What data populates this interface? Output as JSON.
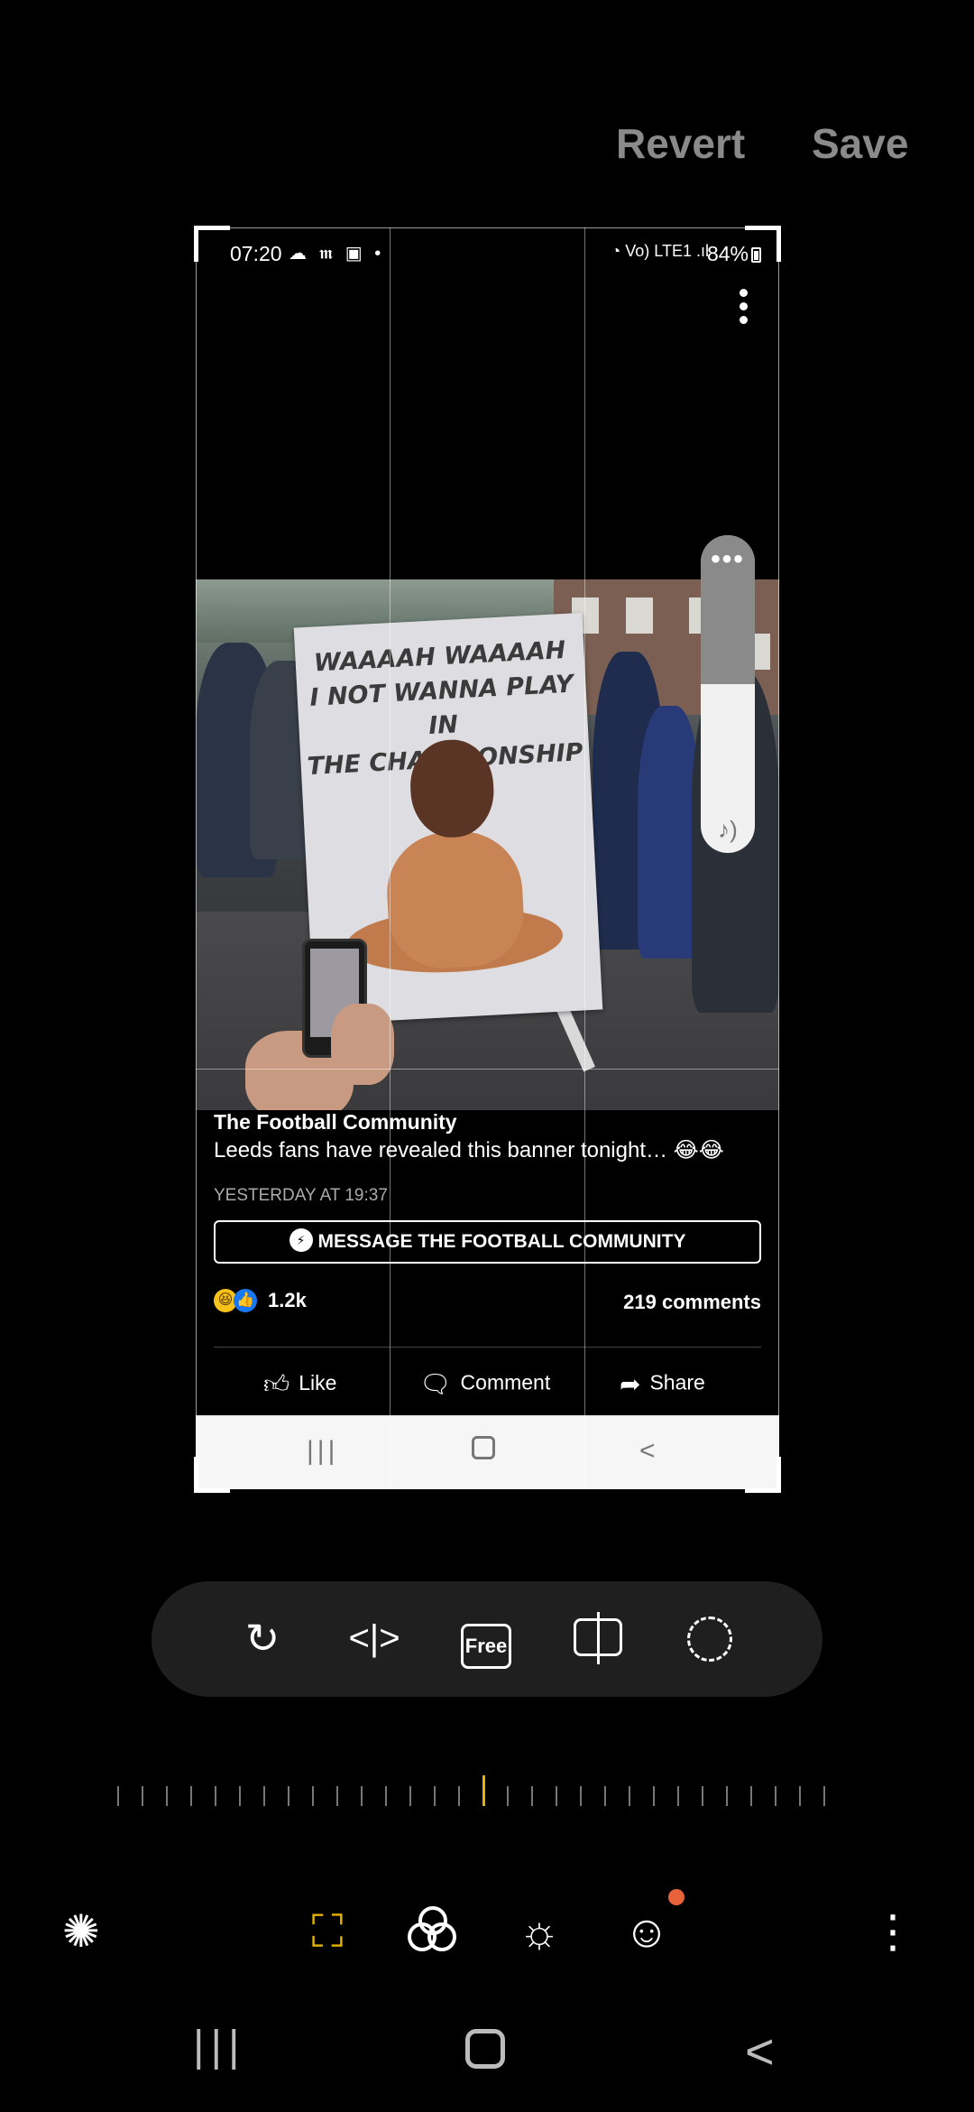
{
  "header": {
    "revert_label": "Revert",
    "save_label": "Save"
  },
  "screenshot": {
    "status_bar": {
      "time": "07:20",
      "left_icons": "☁ 𝖒 ▣ •",
      "right_icons": "◔ Vo) LTE1 .ıl",
      "battery": "84%"
    },
    "photo": {
      "banner_text_1": "WAAAAH WAAAAH",
      "banner_text_2": "I NOT WANNA PLAY IN",
      "banner_text_3": "THE CHAMPIONSHIP"
    },
    "volume_level": 0.53,
    "post": {
      "page_name": "The Football Community",
      "text": "Leeds fans have revealed this banner tonight… 😂😂",
      "timestamp": "YESTERDAY AT 19:37",
      "message_button": "MESSAGE THE FOOTBALL COMMUNITY",
      "reaction_count": "1.2k",
      "comments_count": "219 comments",
      "actions": {
        "like": "Like",
        "comment": "Comment",
        "share": "Share"
      }
    }
  },
  "transform_tools": [
    {
      "name": "rotate",
      "icon": "rotate-icon"
    },
    {
      "name": "flip",
      "icon": "flip-horizontal-icon"
    },
    {
      "name": "free",
      "label": "Free"
    },
    {
      "name": "perspective",
      "icon": "perspective-icon"
    },
    {
      "name": "lasso",
      "icon": "lasso-icon"
    }
  ],
  "edit_menu": [
    "auto-enhance-icon",
    "transform-icon",
    "filter-icon",
    "tone-icon",
    "decoration-icon",
    "more-icon"
  ],
  "colors": {
    "accent": "#e6b400",
    "badge": "#e8633a",
    "toolbar_bg": "#1f1f1f"
  }
}
